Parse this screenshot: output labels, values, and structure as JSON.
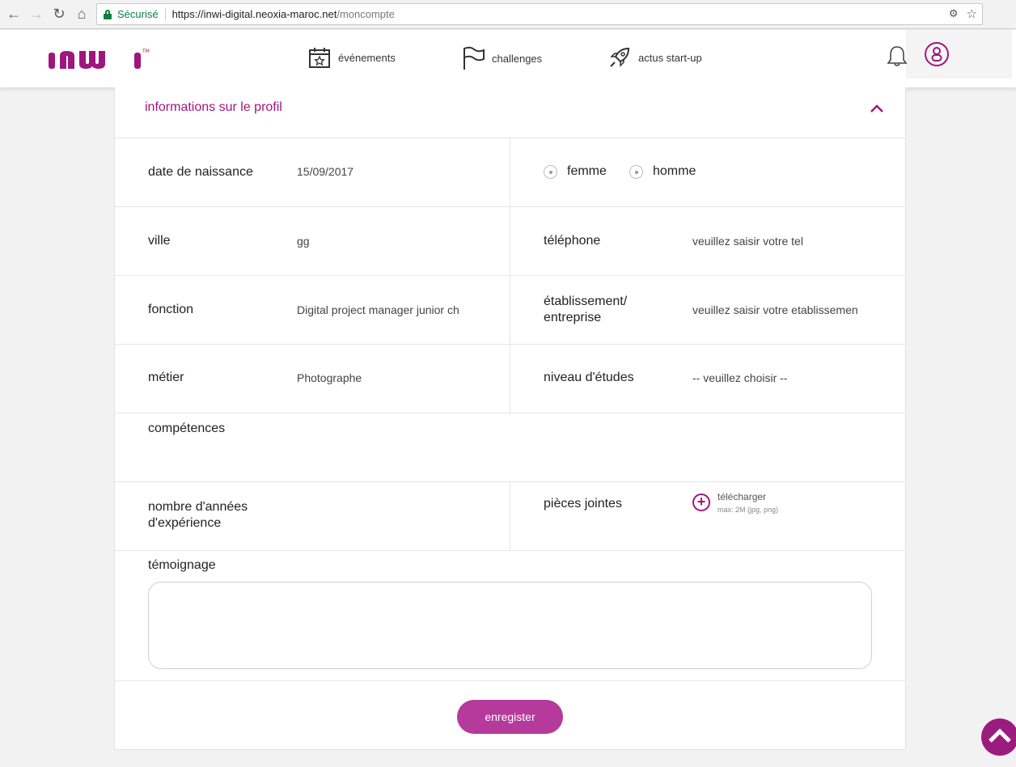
{
  "browser": {
    "secure_label": "Sécurisé",
    "url_host": "https://inwi-digital.neoxia-maroc.net",
    "url_path": "/moncompte"
  },
  "header": {
    "logo_text": "inwi",
    "brand_color": "#a0167f",
    "nav": [
      {
        "label": "événements",
        "icon": "calendar-star-icon"
      },
      {
        "label": "challenges",
        "icon": "flag-icon"
      },
      {
        "label": "actus start-up",
        "icon": "rocket-icon"
      }
    ]
  },
  "profile": {
    "section_title": "informations sur le profil",
    "birthdate": {
      "label": "date de naissance",
      "value": "15/09/2017"
    },
    "gender": {
      "options": [
        "femme",
        "homme"
      ]
    },
    "ville": {
      "label": "ville",
      "value": "gg"
    },
    "telephone": {
      "label": "téléphone",
      "placeholder": "veuillez saisir votre tel"
    },
    "fonction": {
      "label": "fonction",
      "value": "Digital project manager junior ch"
    },
    "etablissement": {
      "label_line1": "établissement/",
      "label_line2": "entreprise",
      "placeholder": "veuillez saisir votre etablissemen"
    },
    "metier": {
      "label": "métier",
      "value": "Photographe"
    },
    "niveau": {
      "label": "niveau d'études",
      "value": "-- veuillez choisir --"
    },
    "competences": {
      "label": "compétences"
    },
    "experience": {
      "label_line1": "nombre d'années",
      "label_line2": "d'expérience"
    },
    "pieces": {
      "label": "pièces jointes",
      "upload_label": "télécharger",
      "upload_hint": "max: 2M (jpg, png)"
    },
    "temoignage": {
      "label": "témoignage"
    },
    "save_label": "enregister"
  }
}
